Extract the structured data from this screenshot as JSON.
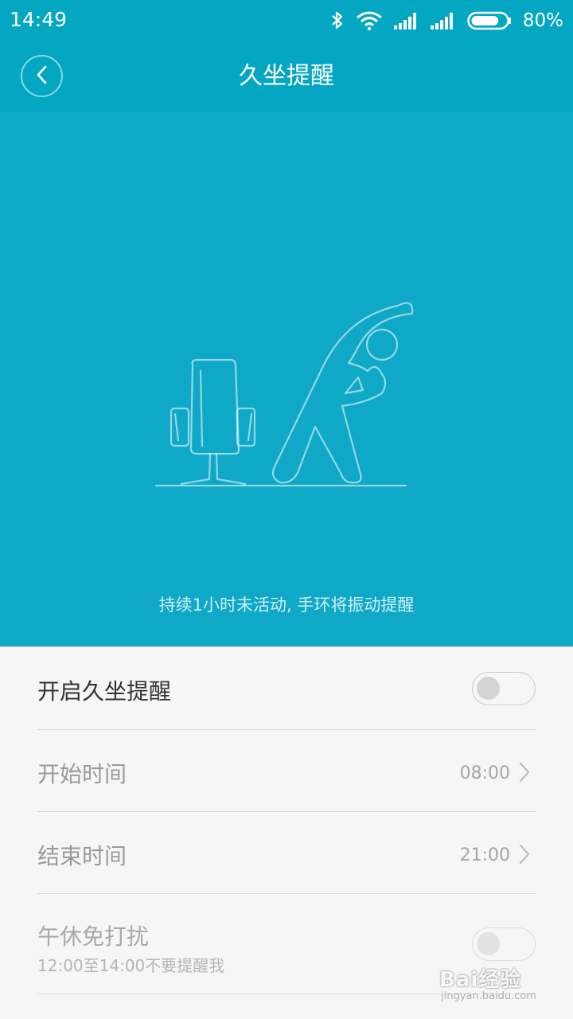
{
  "status_bar": {
    "time": "14:49",
    "battery_percent_text": "80%",
    "battery_level": 0.8,
    "icons": [
      "bluetooth-icon",
      "wifi-icon",
      "signal-icon",
      "signal-icon",
      "battery-icon"
    ]
  },
  "app_bar": {
    "title": "久坐提醒",
    "back_icon": "chevron-left-icon"
  },
  "hero": {
    "caption": "持续1小时未活动, 手环将振动提醒",
    "illustration": "chair-and-stretching-person"
  },
  "settings": {
    "enable": {
      "label": "开启久坐提醒",
      "on": false
    },
    "start_time": {
      "label": "开始时间",
      "value": "08:00"
    },
    "end_time": {
      "label": "结束时间",
      "value": "21:00"
    },
    "nap_dnd": {
      "label": "午休免打扰",
      "sublabel": "12:00至14:00不要提醒我",
      "on": false
    }
  },
  "watermark": {
    "main": "Bai经验",
    "sub": "jingyan.baidu.com"
  },
  "colors": {
    "primary": "#04a7c2",
    "hero": "#0fa9c7",
    "background": "#f6f6f6"
  }
}
